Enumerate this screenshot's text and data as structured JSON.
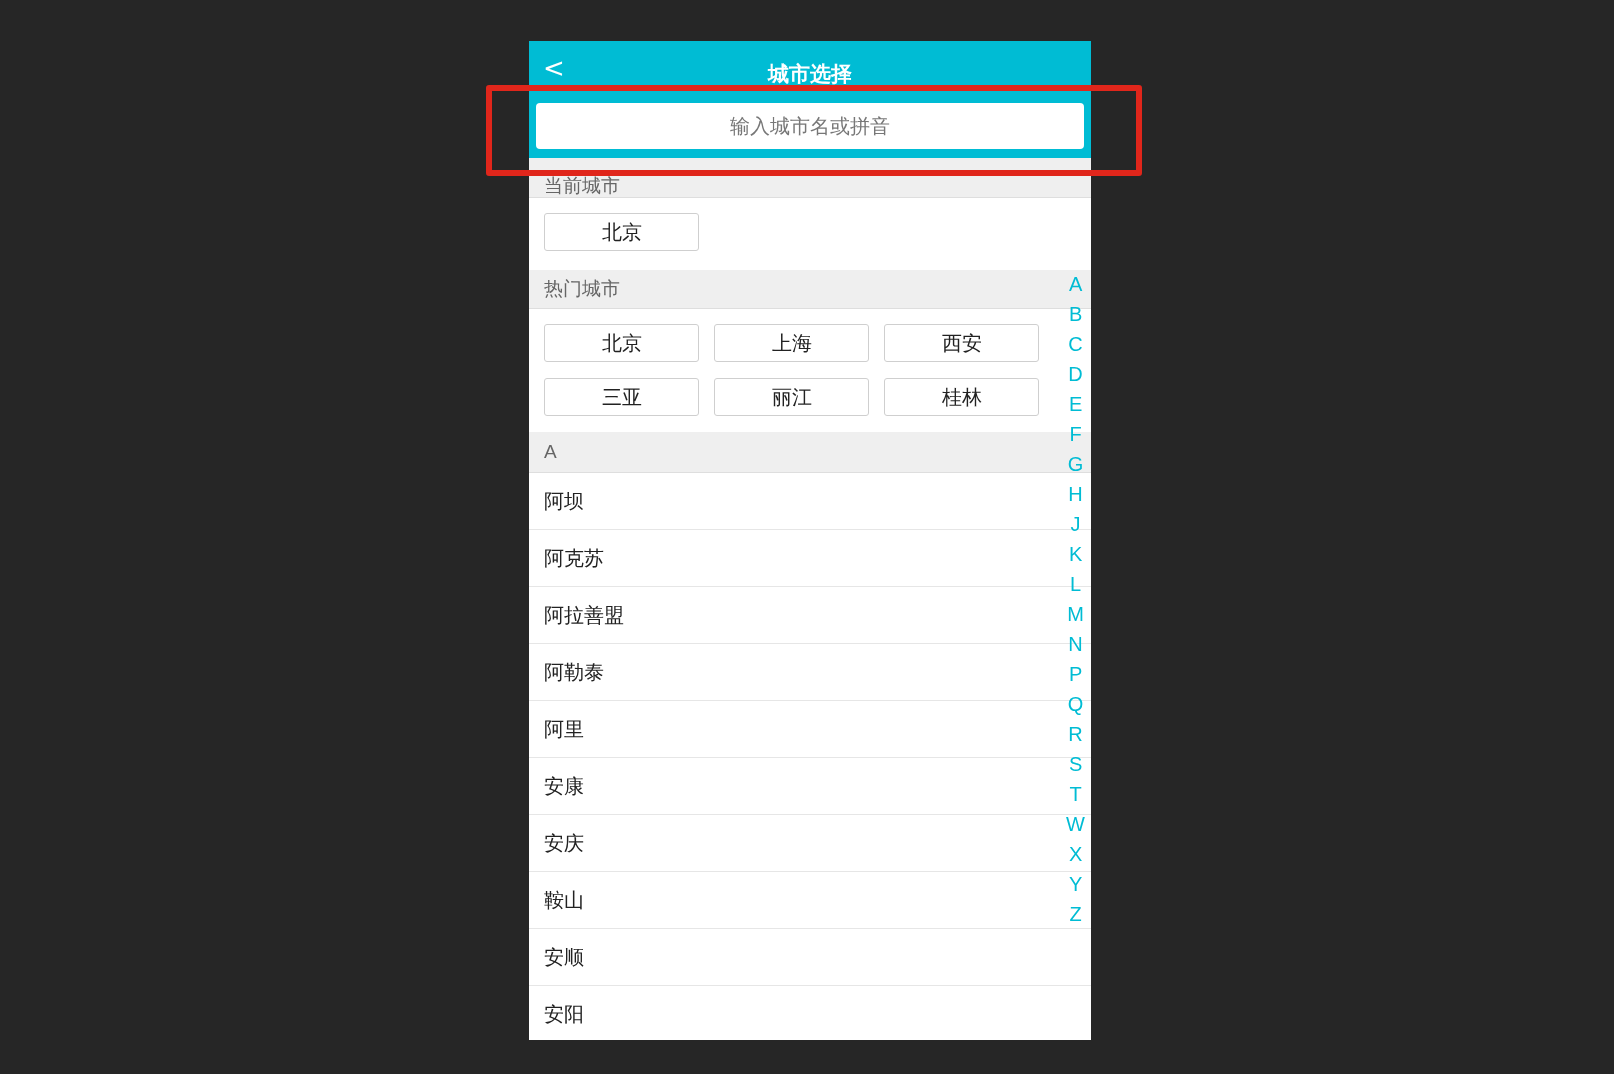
{
  "header": {
    "back": "<",
    "title": "城市选择"
  },
  "search": {
    "placeholder": "输入城市名或拼音"
  },
  "annotation": {
    "kind": "highlight-box"
  },
  "current": {
    "label": "当前城市",
    "cities": [
      "北京"
    ]
  },
  "hot": {
    "label": "热门城市",
    "cities": [
      "北京",
      "上海",
      "西安",
      "三亚",
      "丽江",
      "桂林"
    ]
  },
  "sections": [
    {
      "letter": "A",
      "cities": [
        "阿坝",
        "阿克苏",
        "阿拉善盟",
        "阿勒泰",
        "阿里",
        "安康",
        "安庆",
        "鞍山",
        "安顺",
        "安阳"
      ]
    }
  ],
  "index": [
    "A",
    "B",
    "C",
    "D",
    "E",
    "F",
    "G",
    "H",
    "J",
    "K",
    "L",
    "M",
    "N",
    "P",
    "Q",
    "R",
    "S",
    "T",
    "W",
    "X",
    "Y",
    "Z"
  ]
}
